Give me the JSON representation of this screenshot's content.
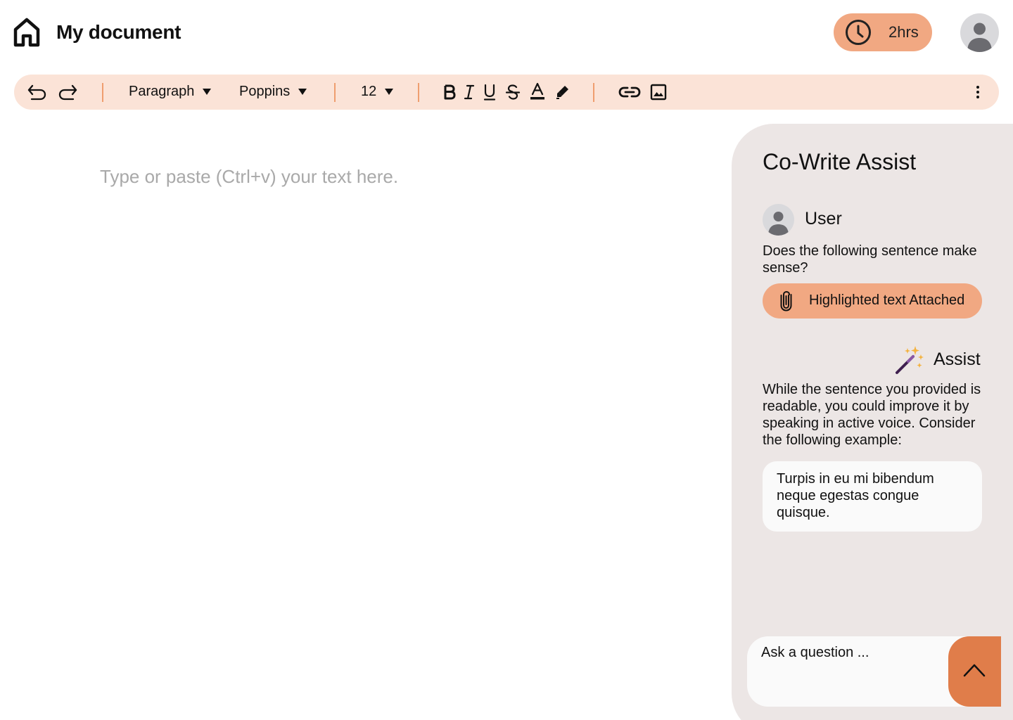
{
  "header": {
    "title": "My document",
    "timer_label": "2hrs",
    "home_icon": "home-icon",
    "clock_icon": "clock-icon",
    "profile_icon": "user-avatar-icon"
  },
  "toolbar": {
    "block_style": "Paragraph",
    "font": "Poppins",
    "font_size": "12",
    "icons": [
      "undo-icon",
      "redo-icon",
      "bold-icon",
      "italic-icon",
      "underline-icon",
      "strikethrough-icon",
      "text-color-icon",
      "highlighter-icon",
      "link-icon",
      "image-icon",
      "more-vertical-icon"
    ]
  },
  "editor": {
    "placeholder": "Type or paste (Ctrl+v) your text here."
  },
  "assist": {
    "title": "Co-Write Assist",
    "user_name": "User",
    "user_message": "Does the following sentence make sense?",
    "attachment_label": "Highlighted text Attached",
    "assistant_name": "Assist",
    "assistant_message": "While the sentence you provided is readable, you could improve it by speaking in active voice. Consider the following example:",
    "example_text": "Turpis in eu mi bibendum neque egestas congue quisque.",
    "question_placeholder": "Ask a question ..."
  },
  "colors": {
    "accent": "#f1a882",
    "toolbar_bg": "#fbe3d7",
    "separator": "#ef9e6f",
    "panel_bg": "#ece6e5",
    "send_button": "#e07d4a"
  }
}
